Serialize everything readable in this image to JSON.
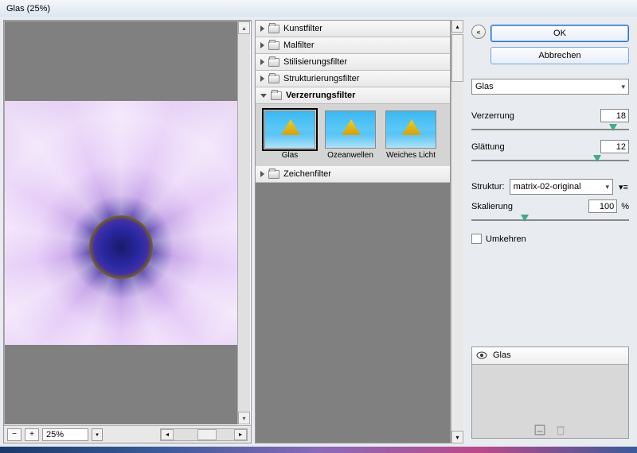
{
  "window": {
    "title": "Glas (25%)"
  },
  "preview": {
    "zoom": "25%"
  },
  "filterTree": {
    "categories": [
      {
        "label": "Kunstfilter",
        "expanded": false
      },
      {
        "label": "Malfilter",
        "expanded": false
      },
      {
        "label": "Stilisierungsfilter",
        "expanded": false
      },
      {
        "label": "Strukturierungsfilter",
        "expanded": false
      },
      {
        "label": "Verzerrungsfilter",
        "expanded": true
      },
      {
        "label": "Zeichenfilter",
        "expanded": false
      }
    ],
    "thumbs": [
      {
        "label": "Glas",
        "selected": true
      },
      {
        "label": "Ozeanwellen",
        "selected": false
      },
      {
        "label": "Weiches Licht",
        "selected": false
      }
    ]
  },
  "buttons": {
    "ok": "OK",
    "cancel": "Abbrechen"
  },
  "filterSelect": {
    "value": "Glas"
  },
  "sliders": {
    "verzerrung": {
      "label": "Verzerrung",
      "value": "18",
      "pos": 90
    },
    "glaettung": {
      "label": "Glättung",
      "value": "12",
      "pos": 80
    },
    "skalierung": {
      "label": "Skalierung",
      "value": "100",
      "unit": "%",
      "pos": 34
    }
  },
  "struktur": {
    "label": "Struktur:",
    "value": "matrix-02-original"
  },
  "umkehren": {
    "label": "Umkehren",
    "checked": false
  },
  "layers": {
    "items": [
      {
        "label": "Glas",
        "visible": true
      }
    ]
  }
}
